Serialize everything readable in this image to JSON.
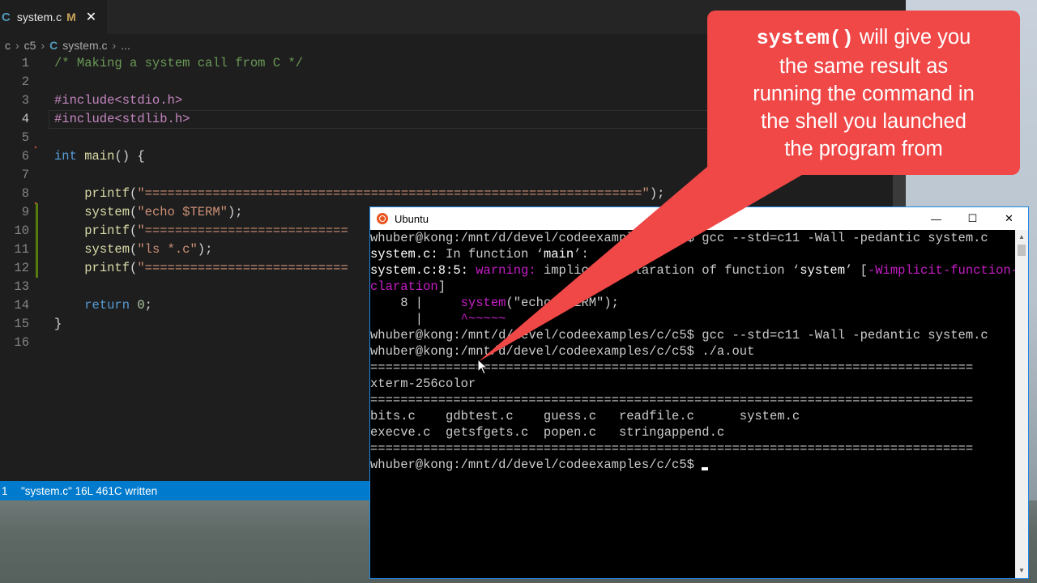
{
  "editor": {
    "tab": {
      "icon": "c-file-icon",
      "icon_glyph": "C",
      "filename": "system.c",
      "modified": "M",
      "close": "✕"
    },
    "breadcrumb": [
      "c",
      "c5",
      "system.c",
      "..."
    ],
    "breadcrumb_icon": "C",
    "current_line": 4,
    "lines": [
      {
        "n": "1",
        "html": "<span class=\"tok-comment\">/* Making a system call from C */</span>"
      },
      {
        "n": "2",
        "html": ""
      },
      {
        "n": "3",
        "html": "<span class=\"tok-pre\">#include&lt;stdio.h&gt;</span>"
      },
      {
        "n": "4",
        "html": "<span class=\"tok-pre\">#include&lt;stdlib.h&gt;</span>"
      },
      {
        "n": "5",
        "html": ""
      },
      {
        "n": "6",
        "html": "<span class=\"tok-key\">int</span> <span class=\"tok-fn\">main</span>() {"
      },
      {
        "n": "7",
        "html": ""
      },
      {
        "n": "8",
        "html": "    <span class=\"tok-fn\">printf</span>(<span class=\"tok-str\">\"==================================================================\"</span>);"
      },
      {
        "n": "9",
        "html": "    <span class=\"tok-fn\">system</span>(<span class=\"tok-str\">\"echo $TERM\"</span>);"
      },
      {
        "n": "10",
        "html": "    <span class=\"tok-fn\">printf</span>(<span class=\"tok-str\">\"===========================</span>"
      },
      {
        "n": "11",
        "html": "    <span class=\"tok-fn\">system</span>(<span class=\"tok-str\">\"ls *.c\"</span>);"
      },
      {
        "n": "12",
        "html": "    <span class=\"tok-fn\">printf</span>(<span class=\"tok-str\">\"===========================</span>"
      },
      {
        "n": "13",
        "html": ""
      },
      {
        "n": "14",
        "html": "    <span class=\"tok-key\">return</span> <span class=\"tok-num\">0</span>;"
      },
      {
        "n": "15",
        "html": "}"
      },
      {
        "n": "16",
        "html": ""
      }
    ],
    "status": {
      "num": "1",
      "message": "\"system.c\" 16L 461C written"
    }
  },
  "callout": {
    "code_word": "system()",
    "text_after_code": " will give you",
    "lines": [
      "the same result as",
      "running the command in",
      "the shell you launched",
      "the program from"
    ],
    "color": "#f04747"
  },
  "terminal": {
    "title": "Ubuntu",
    "icon": "ubuntu-logo-icon",
    "controls": {
      "minimize": "—",
      "maximize": "☐",
      "close": "✕"
    },
    "lines": [
      {
        "html": "whuber@kong:/mnt/d/devel/codeexamples/c/c5$ gcc --std=c11 -Wall -pedantic system.c"
      },
      {
        "html": "<span class=\"t-bold\">system.c:</span> In function ‘<span class=\"t-bold\">main</span>’:"
      },
      {
        "html": "<span class=\"t-bold\">system.c:8:5:</span> <span class=\"t-warn\">warning:</span> implicit declaration of function ‘<span class=\"t-bold\">system</span>’ [<span class=\"t-warn\">-Wimplicit-function-de</span>"
      },
      {
        "html": "<span class=\"t-warn\">claration</span>]"
      },
      {
        "html": "    8 |     <span class=\"t-warn\">system</span>(\"echo $TERM\");"
      },
      {
        "html": "      |     <span class=\"t-warn\">^~~~~~</span>"
      },
      {
        "html": "whuber@kong:/mnt/d/devel/codeexamples/c/c5$ gcc --std=c11 -Wall -pedantic system.c"
      },
      {
        "html": "whuber@kong:/mnt/d/devel/codeexamples/c/c5$ ./a.out"
      },
      {
        "html": "================================================================================"
      },
      {
        "html": "xterm-256color"
      },
      {
        "html": "================================================================================"
      },
      {
        "html": "bits.c    gdbtest.c    guess.c   readfile.c      system.c"
      },
      {
        "html": "execve.c  getsfgets.c  popen.c   stringappend.c"
      },
      {
        "html": "================================================================================"
      },
      {
        "html": "whuber@kong:/mnt/d/devel/codeexamples/c/c5$ <span class=\"cursor\"></span>"
      }
    ]
  }
}
